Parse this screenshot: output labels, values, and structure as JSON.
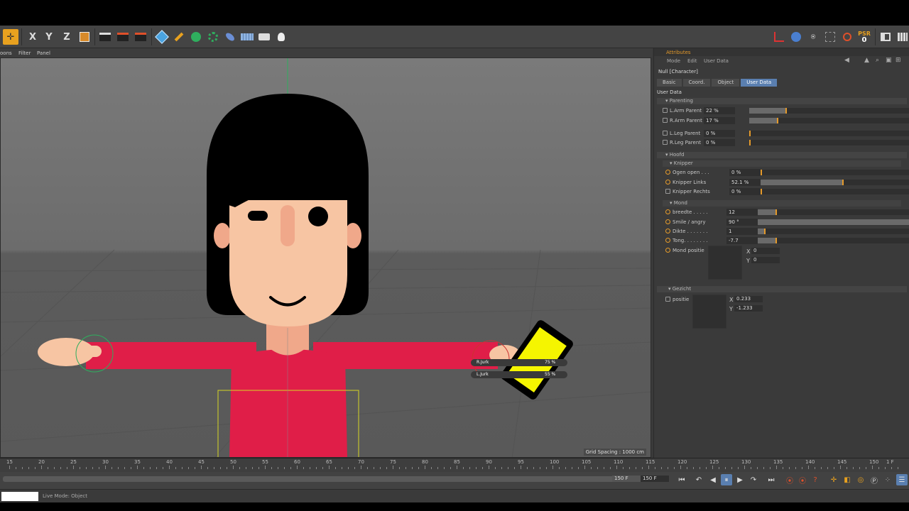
{
  "toolbar": {
    "axis_x": "X",
    "axis_y": "Y",
    "axis_z": "Z",
    "psr_label": "PSR",
    "psr_value": "0"
  },
  "viewport_menu": {
    "items": [
      "oons",
      "Filter",
      "Panel"
    ]
  },
  "viewport": {
    "grid_spacing": "Grid Spacing : 1000 cm",
    "hud": [
      {
        "label": "R.Jurk",
        "value": "75 %"
      },
      {
        "label": "L.Jurk",
        "value": "55 %"
      }
    ]
  },
  "attributes": {
    "title": "Attributes",
    "menu": [
      "Mode",
      "Edit",
      "User Data"
    ],
    "object_name": "Null [Character]",
    "tabs": [
      "Basic",
      "Coord.",
      "Object",
      "User Data"
    ],
    "active_tab": "User Data",
    "section_label": "User Data",
    "groups": {
      "parenting": "Parenting",
      "hoofd": "Hoofd",
      "knipper": "Knipper",
      "mond": "Mond",
      "gezicht": "Gezicht"
    },
    "parenting": [
      {
        "label": "L.Arm Parent",
        "value": "22 %",
        "fraction": 0.22
      },
      {
        "label": "R.Arm Parent",
        "value": "17 %",
        "fraction": 0.17
      },
      {
        "label": "L.Leg Parent",
        "value": "0 %",
        "fraction": 0.0
      },
      {
        "label": "R.Leg Parent",
        "value": "0 %",
        "fraction": 0.0
      }
    ],
    "knipper": [
      {
        "label": "Ogen open . . .",
        "value": "0 %",
        "fraction": 0.0
      },
      {
        "label": "Knipper Links",
        "value": "52.1 %",
        "fraction": 0.521
      },
      {
        "label": "Knipper Rechts",
        "value": "0 %",
        "fraction": 0.0
      }
    ],
    "mond": [
      {
        "label": "breedte . . . . .",
        "value": "12",
        "fraction": 0.12
      },
      {
        "label": "Smile / angry",
        "value": "90 °",
        "fraction": 1.0
      },
      {
        "label": "Dikte . . . . . . .",
        "value": "1",
        "fraction": 0.05
      },
      {
        "label": "Tong. . . . . . . .",
        "value": "-7.7",
        "fraction": 0.12
      }
    ],
    "mond_positie": {
      "label": "Mond positie",
      "x_label": "X",
      "x": "0",
      "y_label": "Y",
      "y": "0"
    },
    "gezicht_positie": {
      "label": "positie",
      "x_label": "X",
      "x": "0.233",
      "y_label": "Y",
      "y": "-1.233"
    }
  },
  "timeline": {
    "ticks": [
      "15",
      "20",
      "25",
      "30",
      "35",
      "40",
      "45",
      "50",
      "55",
      "60",
      "65",
      "70",
      "75",
      "80",
      "85",
      "90",
      "95",
      "100",
      "105",
      "110",
      "115",
      "120",
      "125",
      "130",
      "135",
      "140",
      "145",
      "150"
    ],
    "current_frame": "1 F",
    "end_field_a": "150 F",
    "end_field_b": "150 F"
  },
  "status": {
    "text": "Live Mode: Object"
  }
}
